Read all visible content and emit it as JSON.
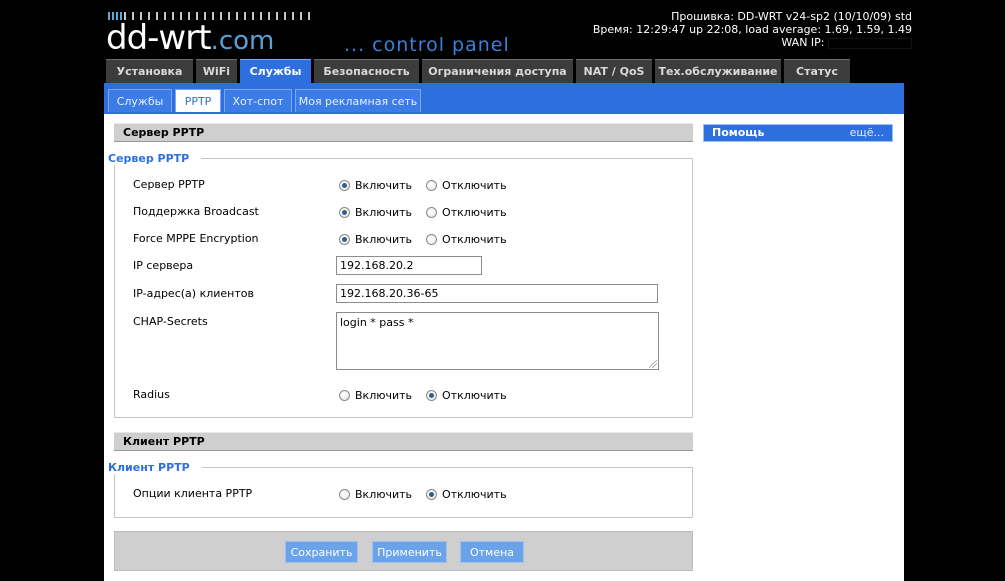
{
  "header": {
    "logo_main": "dd-wrt",
    "logo_suffix": ".com",
    "logo_sub": "... control panel",
    "firmware": "Прошивка: DD-WRT v24-sp2 (10/10/09) std",
    "time": "Время: 12:29:47 up 22:08, load average: 1.69, 1.59, 1.49",
    "wan_label": "WAN IP:"
  },
  "main_tabs": [
    {
      "label": "Установка"
    },
    {
      "label": "WiFi"
    },
    {
      "label": "Службы"
    },
    {
      "label": "Безопасность"
    },
    {
      "label": "Ограничения доступа"
    },
    {
      "label": "NAT / QoS"
    },
    {
      "label": "Тех.обслуживание"
    },
    {
      "label": "Статус"
    }
  ],
  "sub_tabs": [
    {
      "label": "Службы"
    },
    {
      "label": "PPTP"
    },
    {
      "label": "Хот-спот"
    },
    {
      "label": "Моя рекламная сеть"
    }
  ],
  "server": {
    "section_title": "Сервер PPTP",
    "legend": "Сервер PPTP",
    "rows": [
      {
        "label": "Сервер PPTP",
        "on": "Включить",
        "off": "Отключить",
        "selected": "on"
      },
      {
        "label": "Поддержка Broadcast",
        "on": "Включить",
        "off": "Отключить",
        "selected": "on"
      },
      {
        "label": "Force MPPE Encryption",
        "on": "Включить",
        "off": "Отключить",
        "selected": "on"
      }
    ],
    "server_ip_label": "IP сервера",
    "server_ip_value": "192.168.20.2",
    "client_ip_label": "IP-адрес(а) клиентов",
    "client_ip_value": "192.168.20.36-65",
    "chap_label": "CHAP-Secrets",
    "chap_value": "login * pass *",
    "radius": {
      "label": "Radius",
      "on": "Включить",
      "off": "Отключить",
      "selected": "off"
    }
  },
  "client": {
    "section_title": "Клиент PPTP",
    "legend": "Клиент PPTP",
    "row": {
      "label": "Опции клиента PPTP",
      "on": "Включить",
      "off": "Отключить",
      "selected": "off"
    }
  },
  "buttons": {
    "save": "Сохранить",
    "apply": "Применить",
    "cancel": "Отмена"
  },
  "help": {
    "title": "Помощь",
    "more": "ещё..."
  },
  "colors": {
    "accent": "#2e6fe0",
    "button": "#6aa3e9",
    "section": "#cfcfcf",
    "page_bg": "#000000"
  }
}
